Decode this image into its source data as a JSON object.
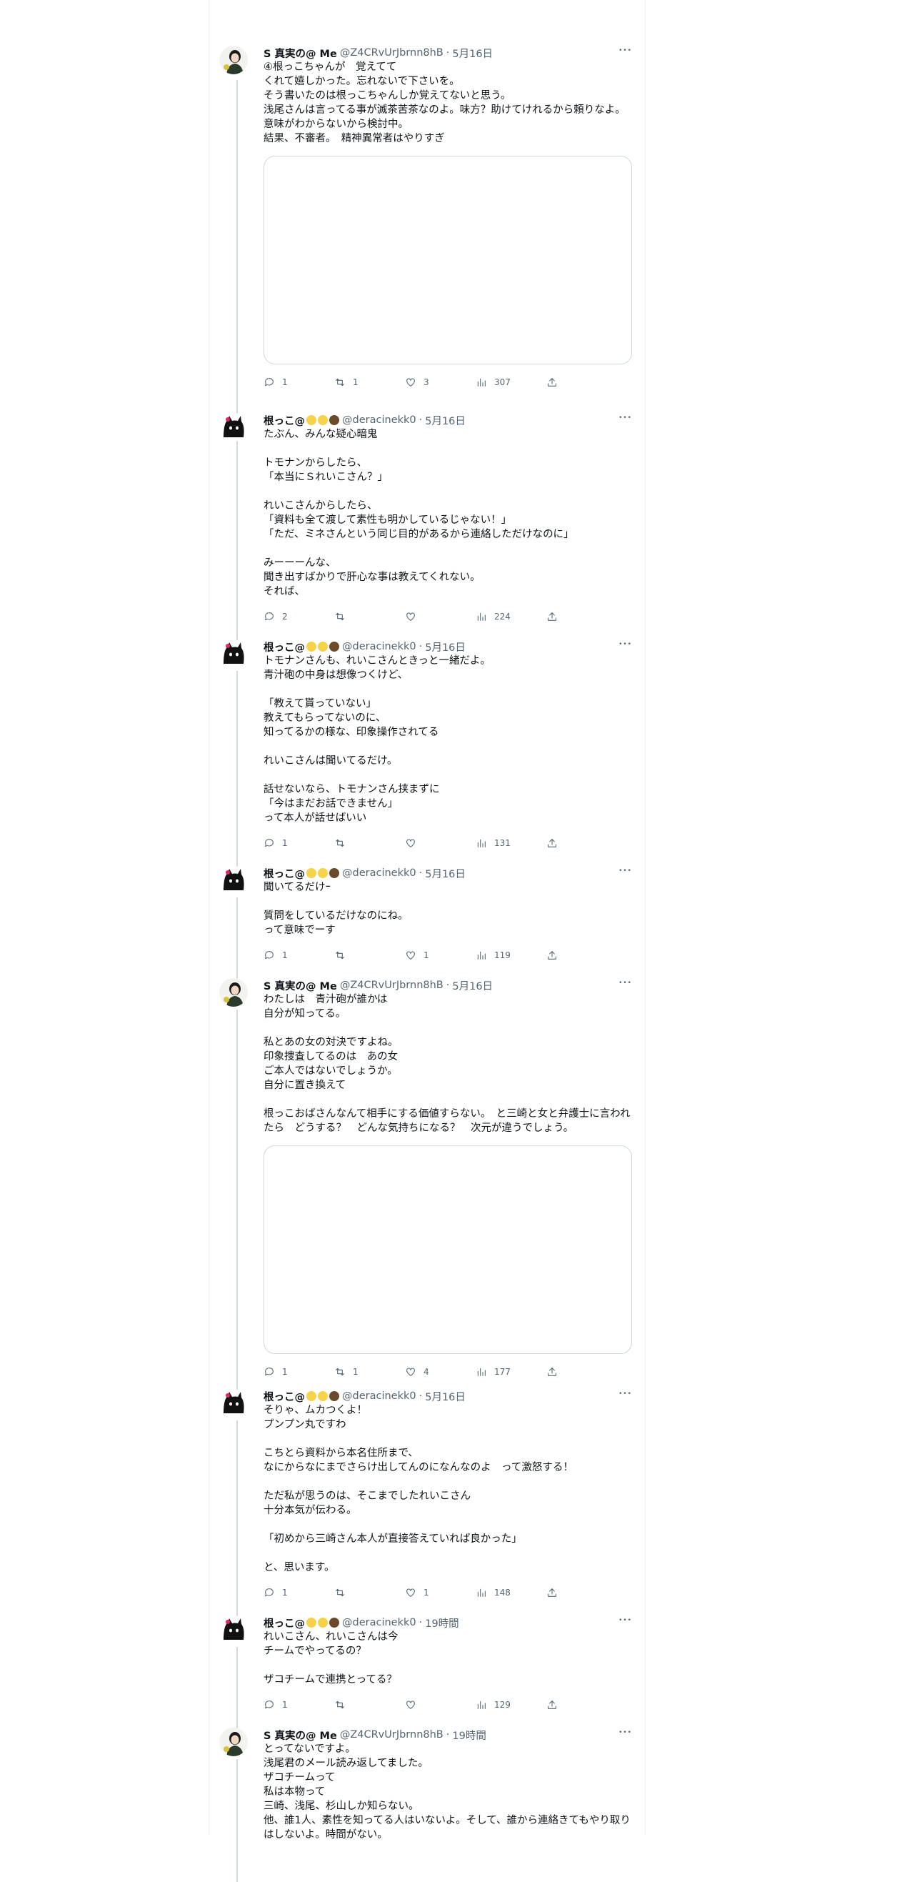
{
  "colors": {
    "accent": "#1d9bf0",
    "muted": "#536471",
    "border": "#cfd9de"
  },
  "tweets": [
    {
      "name": "S 真実の@ Me",
      "handle": "@Z4CRvUrJbrnn8hB",
      "time": "5月16日",
      "avatar": "woman",
      "text": "④根っこちゃんが　覚えてて\nくれて嬉しかった。忘れないで下さいを。\nそう書いたのは根っこちゃんしか覚えてないと思う。\n浅尾さんは言ってる事が滅茶苦茶なのよ。味方？助けてけれるから頼りなよ。\n意味がわからないから検討中。\n結果、不審者。　精神異常者はやりすぎ",
      "media": true,
      "replies": "1",
      "retweets": "1",
      "likes": "3",
      "views": "307"
    },
    {
      "name": "根っこ@",
      "handle": "@deracinekk0",
      "time": "5月16日",
      "avatar": "cat",
      "text": "たぶん、みんな疑心暗鬼\n\nトモナンからしたら、\n「本当にＳれいこさん？」\n\nれいこさんからしたら、\n「資料も全て渡して素性も明かしているじゃない！」\n「ただ、ミネさんという同じ目的があるから連絡しただけなのに」\n\nみーーーんな、\n聞き出すばかりで肝心な事は教えてくれない。\nそれば、",
      "media": false,
      "replies": "2",
      "retweets": "",
      "likes": "",
      "views": "224"
    },
    {
      "name": "根っこ@",
      "handle": "@deracinekk0",
      "time": "5月16日",
      "avatar": "cat",
      "text": "トモナンさんも、れいこさんときっと一緒だよ。\n青汁砲の中身は想像つくけど、\n\n「教えて貰っていない」\n教えてもらってないのに、\n知ってるかの様な、印象操作されてる\n\nれいこさんは聞いてるだけ。\n\n話せないなら、トモナンさん挟まずに\n「今はまだお話できません」\nって本人が話せばいい",
      "media": false,
      "replies": "1",
      "retweets": "",
      "likes": "",
      "views": "131"
    },
    {
      "name": "根っこ@",
      "handle": "@deracinekk0",
      "time": "5月16日",
      "avatar": "cat",
      "text": "聞いてるだけｰ\n\n質問をしているだけなのにね。\nって意味でーす",
      "media": false,
      "replies": "1",
      "retweets": "",
      "likes": "1",
      "views": "119"
    },
    {
      "name": "S 真実の@ Me",
      "handle": "@Z4CRvUrJbrnn8hB",
      "time": "5月16日",
      "avatar": "woman",
      "text": "わたしは　青汁砲が誰かは\n自分が知ってる。\n\n私とあの女の対決ですよね。\n印象捜査してるのは　あの女\nご本人ではないでしょうか。\n自分に置き換えて\n\n根っこおばさんなんて相手にする価値すらない。　と三崎と女と弁護士に言われたら　どうする？　どんな気持ちになる？　次元が違うでしょう。",
      "media": true,
      "replies": "1",
      "retweets": "1",
      "likes": "4",
      "views": "177"
    },
    {
      "name": "根っこ@",
      "handle": "@deracinekk0",
      "time": "5月16日",
      "avatar": "cat",
      "text": "そりゃ、ムカつくよ！\nプンプン丸ですわ\n\nこちとら資料から本名住所まで、\nなにからなにまでさらけ出してんのになんなのよ　って激怒する！\n\nただ私が思うのは、そこまでしたれいこさん\n十分本気が伝わる。\n\n「初めから三崎さん本人が直接答えていれば良かった」\n\nと、思います。",
      "media": false,
      "replies": "1",
      "retweets": "",
      "likes": "1",
      "views": "148"
    },
    {
      "name": "根っこ@",
      "handle": "@deracinekk0",
      "time": "19時間",
      "avatar": "cat",
      "text": "れいこさん、れいこさんは今\nチームでやってるの？\n\nザコチームで連携とってる？",
      "media": false,
      "replies": "1",
      "retweets": "",
      "likes": "",
      "views": "129"
    },
    {
      "name": "S 真実の@ Me",
      "handle": "@Z4CRvUrJbrnn8hB",
      "time": "19時間",
      "avatar": "woman",
      "text": "とってないですよ。\n浅尾君のメール読み返してました。\nザコチームって\n私は本物って\n三崎、浅尾、杉山しか知らない。\n他、誰1人、素性を知ってる人はいないよ。そして、誰から連絡きてもやり取りはしないよ。時間がない。",
      "media": false,
      "replies": "",
      "retweets": "",
      "likes": "",
      "views": ""
    }
  ],
  "icons": {
    "more": "more-icon",
    "reply": "reply-icon",
    "retweet": "retweet-icon",
    "like": "like-icon",
    "views": "views-icon",
    "share": "share-icon"
  }
}
